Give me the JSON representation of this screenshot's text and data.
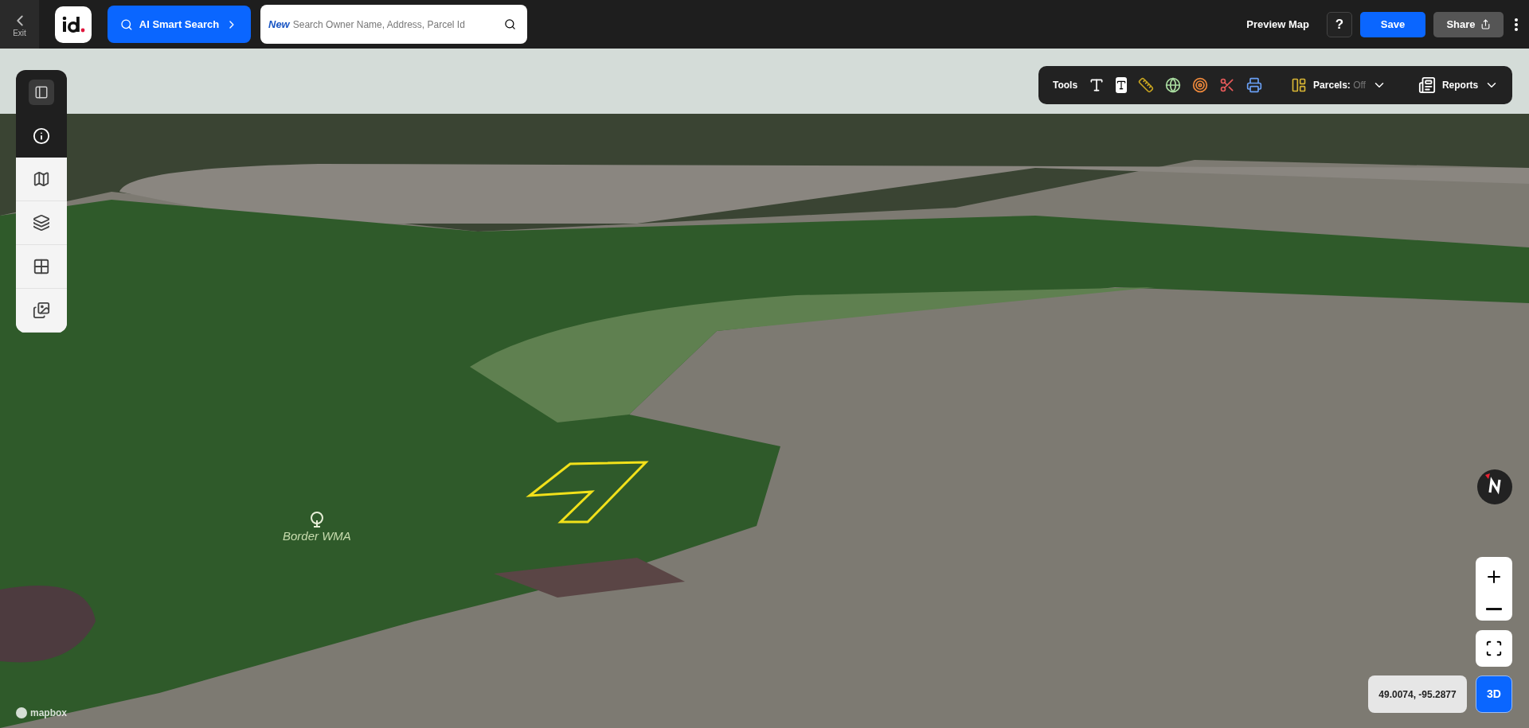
{
  "top_bar": {
    "exit_label": "Exit",
    "smart_search": "AI Smart Search",
    "search": {
      "badge": "New",
      "placeholder": "Search Owner Name, Address, Parcel Id"
    },
    "preview": "Preview Map",
    "help": "?",
    "save": "Save",
    "share": "Share"
  },
  "sidebar": {
    "items": [
      {
        "selected": false
      },
      {
        "selected": true
      },
      {
        "selected": false
      },
      {
        "selected": false
      },
      {
        "selected": false
      },
      {
        "selected": false
      }
    ]
  },
  "toolbar": {
    "label": "Tools",
    "parcels_label": "Parcels:",
    "parcels_value": "Off",
    "reports": "Reports"
  },
  "map": {
    "place_label": "Border WMA",
    "attribution": "mapbox",
    "coordinates": "49.0074, -95.2877",
    "view_mode": "3D"
  }
}
